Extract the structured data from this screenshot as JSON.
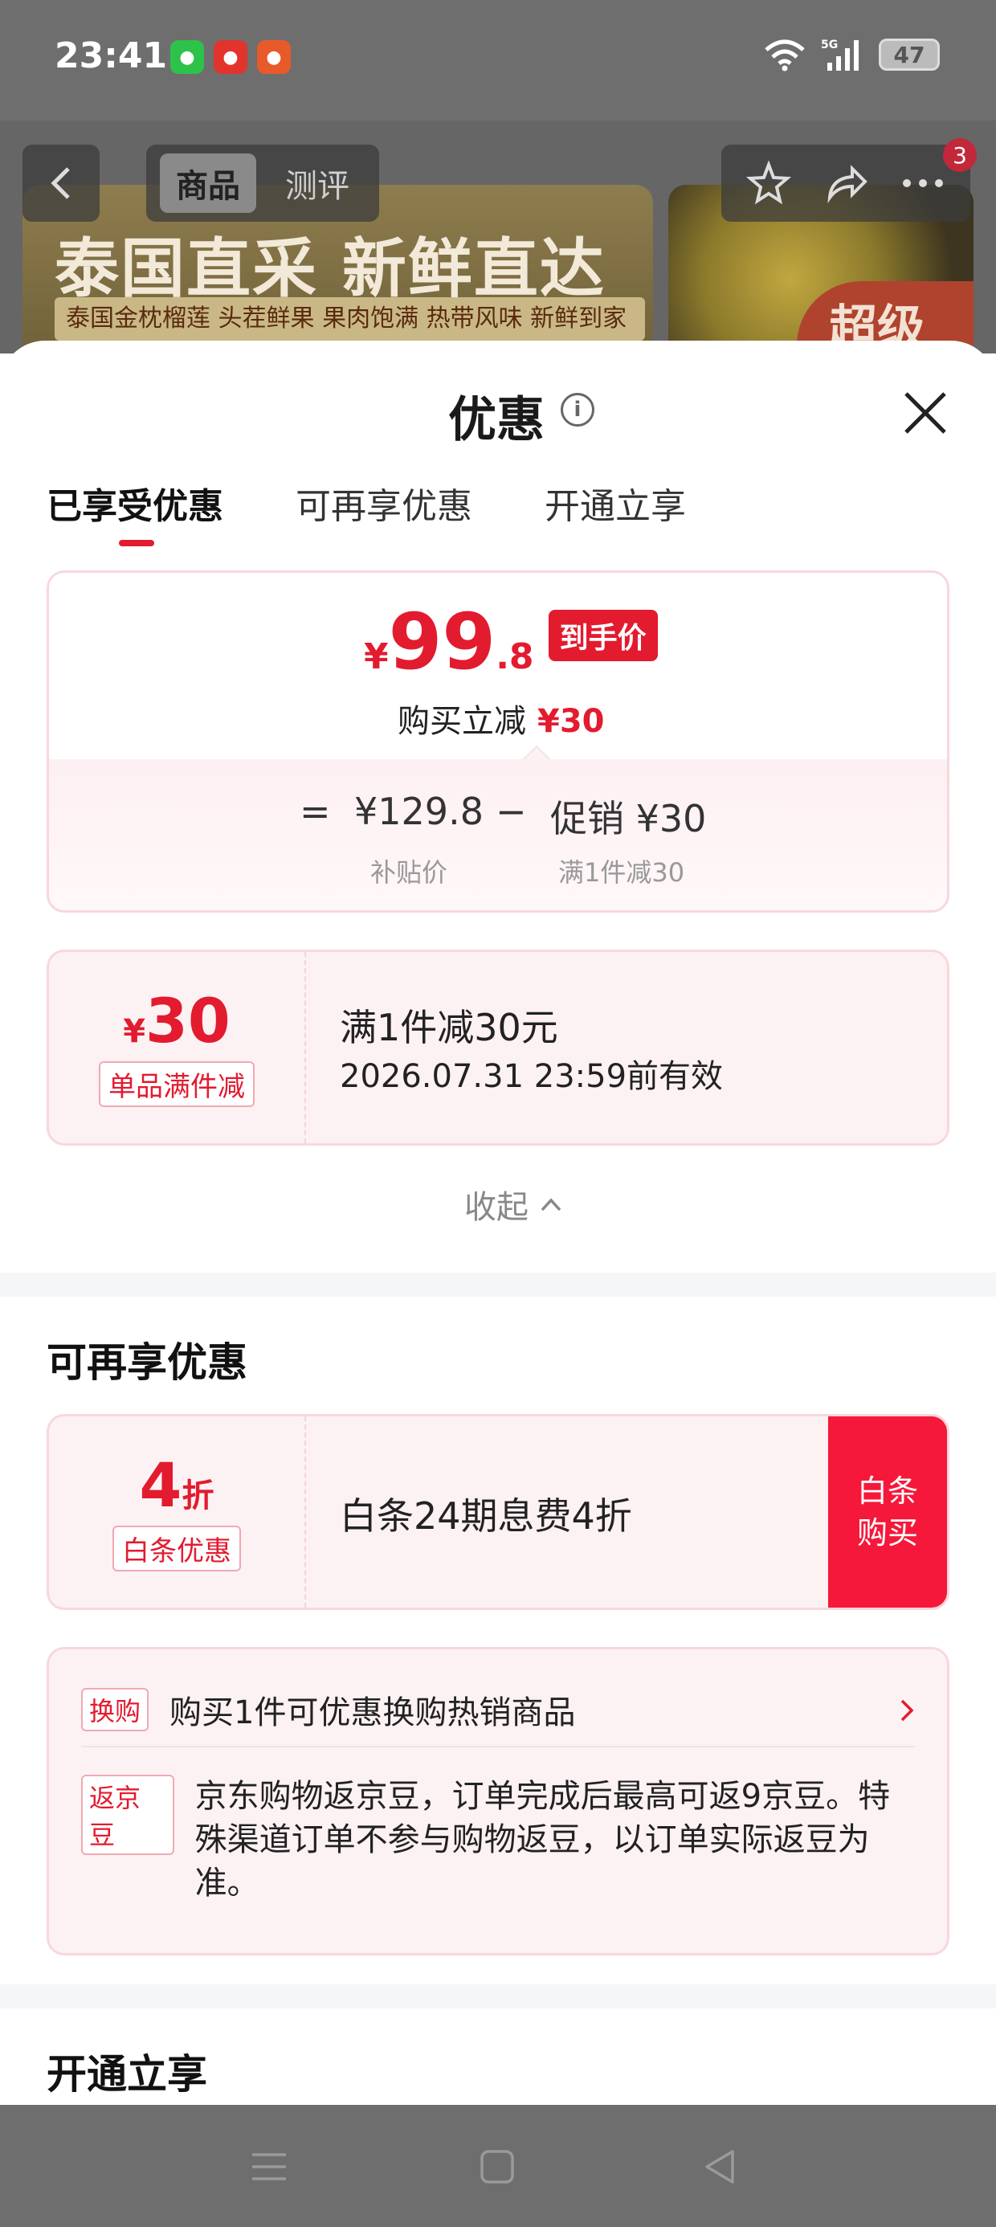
{
  "status_bar": {
    "time": "23:41",
    "apps": [
      "wechat-icon",
      "app-icon-red",
      "app-icon-orange"
    ],
    "network": "5G",
    "battery": "47"
  },
  "product_page": {
    "back_icon": "chevron-left-icon",
    "segments": [
      "商品",
      "测评"
    ],
    "active_segment": "商品",
    "banner_title": "泰国直采 新鲜直达",
    "banner_subtitle": "泰国金枕榴莲 头茬鲜果 果肉饱满 热带风味 新鲜到家",
    "side_tag": "超级",
    "cart_badge": "3"
  },
  "sheet": {
    "title": "优惠",
    "tabs": [
      "已享受优惠",
      "可再享优惠",
      "开通立享"
    ],
    "active_tab": "已享受优惠",
    "price_card": {
      "currency": "¥",
      "price_int": "99",
      "price_dec": ".8",
      "final_tag": "到手价",
      "reduce_label": "购买立减",
      "reduce_amount": "¥30",
      "eq": "=",
      "base_price": "¥129.8",
      "minus": "−",
      "promo_label": "促销 ¥30",
      "base_sub": "补贴价",
      "promo_sub": "满1件减30"
    },
    "coupon_applied": {
      "currency": "¥",
      "amount": "30",
      "label": "单品满件减",
      "title": "满1件减30元",
      "validity": "2026.07.31 23:59前有效"
    },
    "collapse_label": "收起",
    "more_section_title": "可再享优惠",
    "baitiao_coupon": {
      "amount": "4",
      "unit": "折",
      "label": "白条优惠",
      "title": "白条24期息费4折",
      "button_line1": "白条",
      "button_line2": "购买"
    },
    "extra_promos": [
      {
        "tag": "换购",
        "text": "购买1件可优惠换购热销商品"
      },
      {
        "tag": "返京豆",
        "text": "京东购物返京豆，订单完成后最高可返9京豆。特殊渠道订单不参与购物返豆，以订单实际返豆为准。"
      }
    ],
    "open_section_title": "开通立享"
  },
  "colors": {
    "accent_red": "#e31b2f",
    "button_red": "#f5183a",
    "card_bg": "#fdf2f3"
  }
}
